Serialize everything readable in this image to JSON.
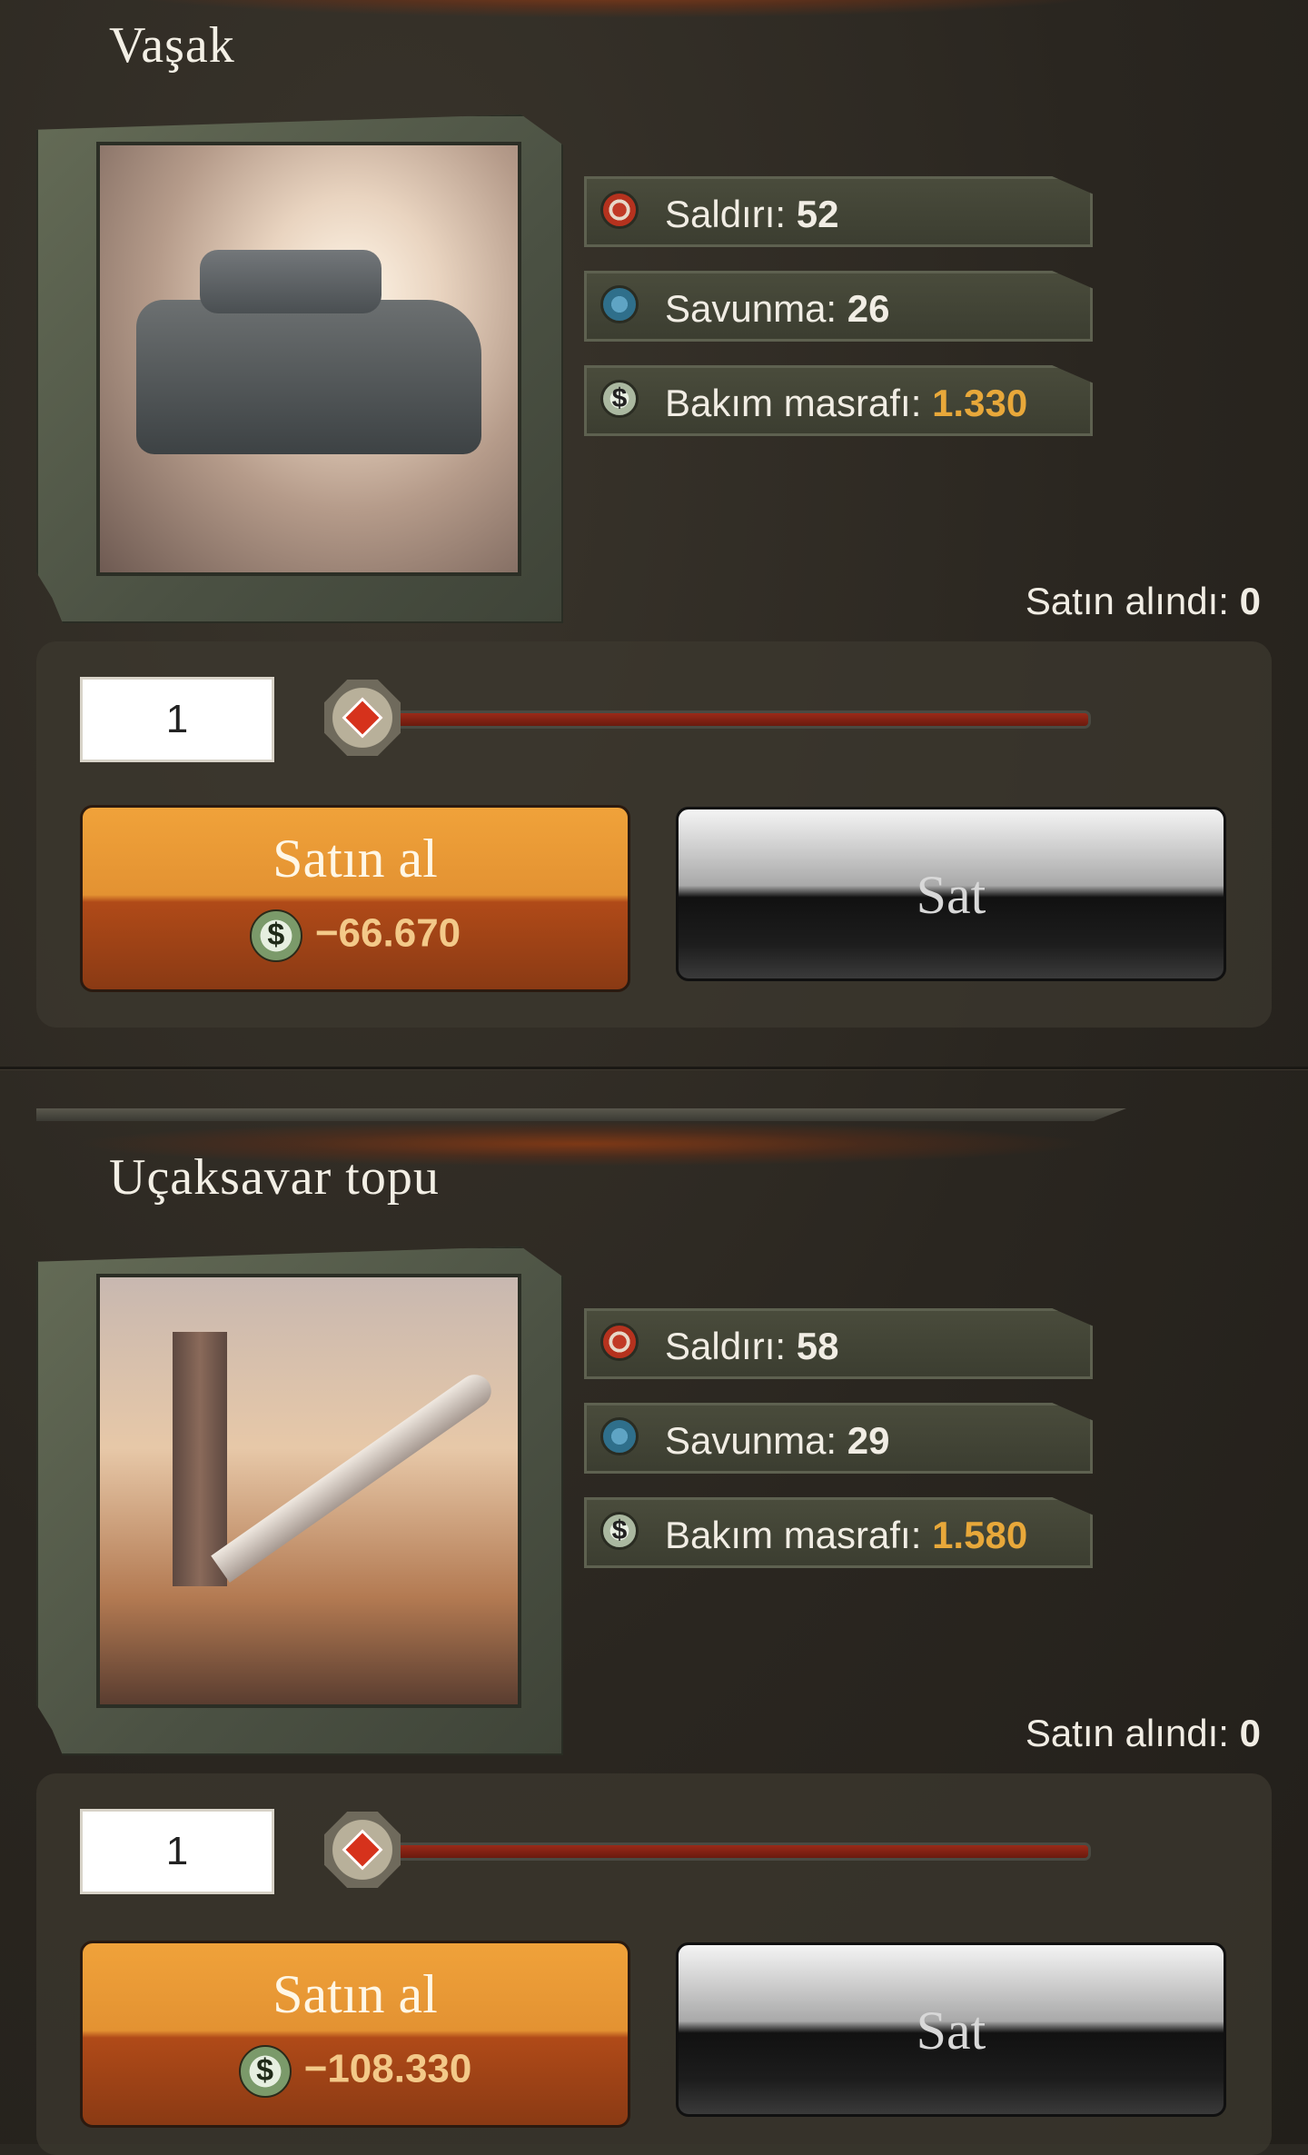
{
  "units": [
    {
      "name": "Vaşak",
      "image_icon": "armored-vehicle-image",
      "stats": {
        "attack_label": "Saldırı:",
        "attack_value": "52",
        "defense_label": "Savunma:",
        "defense_value": "26",
        "upkeep_label": "Bakım masrafı:",
        "upkeep_value": "1.330"
      },
      "bought_label": "Satın alındı:",
      "bought_value": "0",
      "quantity": "1",
      "slider_value": 0,
      "buy_label": "Satın al",
      "buy_price": "−66.670",
      "sell_label": "Sat"
    },
    {
      "name": "Uçaksavar topu",
      "image_icon": "missile-launcher-image",
      "stats": {
        "attack_label": "Saldırı:",
        "attack_value": "58",
        "defense_label": "Savunma:",
        "defense_value": "29",
        "upkeep_label": "Bakım masrafı:",
        "upkeep_value": "1.580"
      },
      "bought_label": "Satın alındı:",
      "bought_value": "0",
      "quantity": "1",
      "slider_value": 0,
      "buy_label": "Satın al",
      "buy_price": "−108.330",
      "sell_label": "Sat"
    }
  ],
  "icons": {
    "attack": "crosshair-icon",
    "defense": "shield-icon",
    "money": "dollar-coin-icon"
  },
  "colors": {
    "accent": "#e8a83a",
    "buy_button": "#e39232",
    "sell_button": "#1d1d1d",
    "slider_knob": "#d6321c"
  }
}
